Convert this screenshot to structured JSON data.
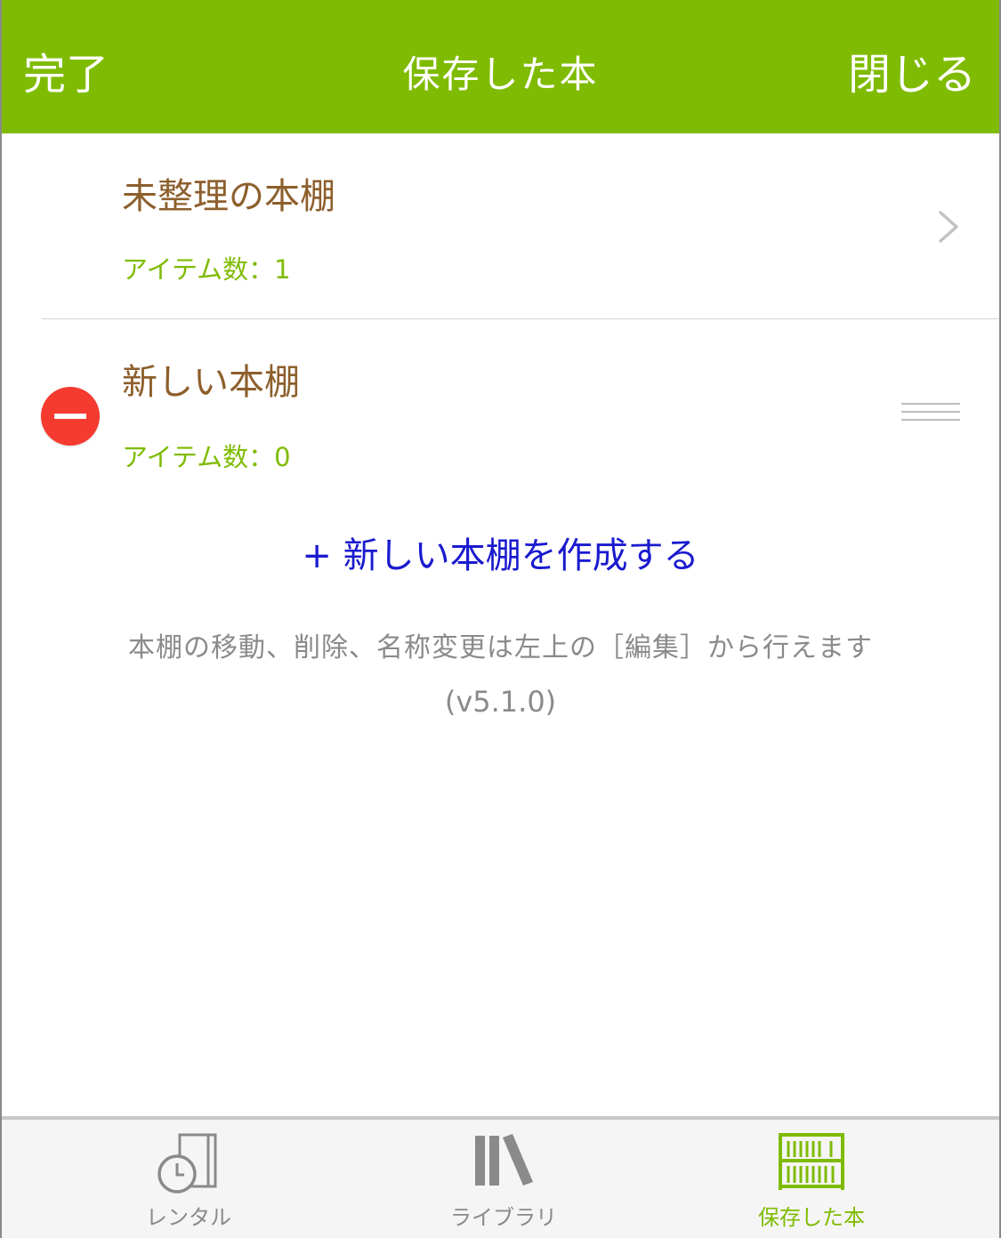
{
  "header": {
    "done_label": "完了",
    "title": "保存した本",
    "close_label": "閉じる"
  },
  "shelves": [
    {
      "name": "未整理の本棚",
      "count": "アイテム数：1"
    },
    {
      "name": "新しい本棚",
      "count": "アイテム数：0"
    }
  ],
  "create_link": "+ 新しい本棚を作成する",
  "hint": "本棚の移動、削除、名称変更は左上の［編集］から行えます",
  "version": "(v5.1.0)",
  "tabs": [
    {
      "label": "レンタル",
      "icon": "rental-clock-book-icon"
    },
    {
      "label": "ライブラリ",
      "icon": "library-books-icon"
    },
    {
      "label": "保存した本",
      "icon": "bookshelf-icon",
      "active": true
    }
  ],
  "colors": {
    "accent": "#7fbb02",
    "shelf_name": "#8d5f2c",
    "link": "#1a1acf",
    "delete": "#f53a2f",
    "muted": "#8a8a8a"
  }
}
